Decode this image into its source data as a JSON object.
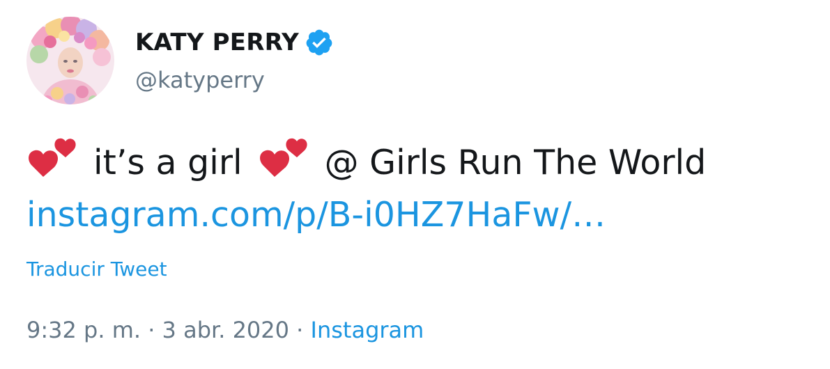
{
  "user": {
    "display_name": "KATY PERRY",
    "handle": "@katyperry",
    "verified": true
  },
  "tweet": {
    "text_part1": "it’s a girl",
    "text_part2": "@ Girls Run The World",
    "link": "instagram.com/p/B-i0HZ7HaFw/…",
    "translate_label": "Traducir Tweet",
    "time": "9:32 p. m.",
    "separator": "·",
    "date": "3 abr. 2020",
    "source": "Instagram"
  },
  "icons": {
    "verified": "verified-badge-icon",
    "heart": "two-hearts-emoji"
  },
  "colors": {
    "text": "#14171a",
    "secondary": "#657786",
    "link": "#1b95e0",
    "heart": "#dd2e44"
  }
}
